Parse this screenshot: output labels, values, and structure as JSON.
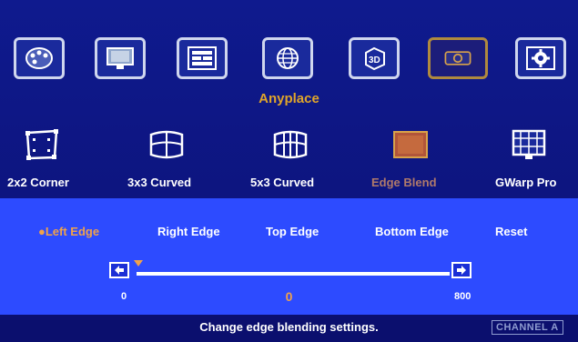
{
  "top_menu": {
    "icons": [
      {
        "name": "palette-icon"
      },
      {
        "name": "monitor-icon"
      },
      {
        "name": "layout-icon"
      },
      {
        "name": "globe-icon"
      },
      {
        "name": "3d-icon"
      },
      {
        "name": "projector-icon",
        "active": true
      },
      {
        "name": "gear-icon"
      }
    ],
    "section_title": "Anyplace"
  },
  "modes": [
    {
      "label": "2x2 Corner",
      "icon": "corner-icon"
    },
    {
      "label": "3x3 Curved",
      "icon": "curved-3x3-icon"
    },
    {
      "label": "5x3 Curved",
      "icon": "curved-5x3-icon"
    },
    {
      "label": "Edge Blend",
      "icon": "edge-blend-icon",
      "active": true
    },
    {
      "label": "GWarp Pro",
      "icon": "gwarp-icon"
    }
  ],
  "tabs": [
    {
      "label": "Left Edge",
      "active": true
    },
    {
      "label": "Right Edge"
    },
    {
      "label": "Top Edge"
    },
    {
      "label": "Bottom Edge"
    },
    {
      "label": "Reset"
    }
  ],
  "slider": {
    "min": "0",
    "max": "800",
    "value": "0"
  },
  "status": {
    "message": "Change edge blending settings.",
    "channel": "CHANNEL A"
  },
  "colors": {
    "background": "#0d1580",
    "panel": "#2d4bff",
    "accent": "#f0a24a",
    "title": "#e0a52a"
  }
}
